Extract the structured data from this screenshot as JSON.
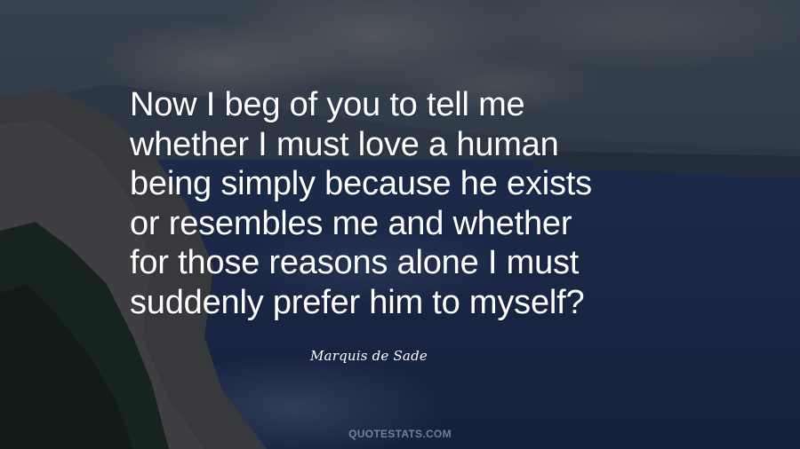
{
  "quote": {
    "lines": [
      "Now I beg of you to tell me",
      "whether I must love a human",
      "being simply because he exists",
      "or resembles me and whether",
      "for those reasons alone I must",
      "suddenly prefer him to myself?"
    ]
  },
  "author": "Marquis de Sade",
  "watermark": "QUOTESTATS.COM",
  "colors": {
    "text": "#ffffff",
    "sky": "#3a4a5c",
    "water": "#1e2f52",
    "forest": "#1a2a1e"
  }
}
